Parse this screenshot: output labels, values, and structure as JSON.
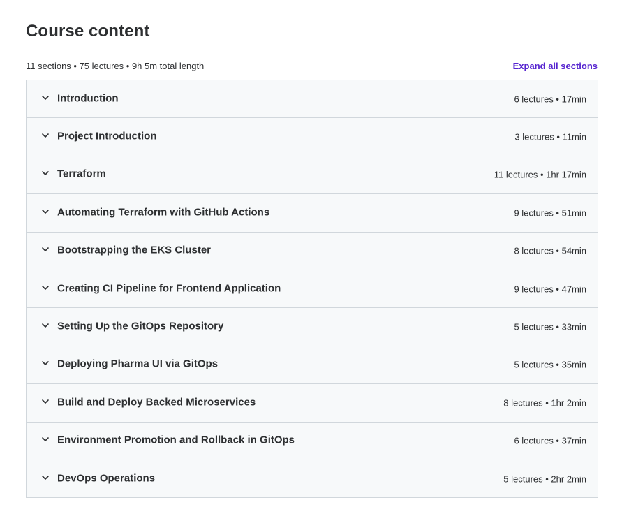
{
  "page": {
    "title": "Course content",
    "summary": "11 sections • 75 lectures • 9h 5m total length",
    "expand_all_label": "Expand all sections"
  },
  "colors": {
    "accent": "#5624d0",
    "section_bg": "#f7f9fa",
    "border": "#d1d7dc",
    "text": "#2d2f31"
  },
  "icons": {
    "section_toggle": "chevron-down-icon"
  },
  "sections": [
    {
      "title": "Introduction",
      "meta": "6 lectures • 17min"
    },
    {
      "title": "Project Introduction",
      "meta": "3 lectures • 11min"
    },
    {
      "title": "Terraform",
      "meta": "11 lectures • 1hr 17min"
    },
    {
      "title": "Automating Terraform with GitHub Actions",
      "meta": "9 lectures • 51min"
    },
    {
      "title": "Bootstrapping the EKS Cluster",
      "meta": "8 lectures • 54min"
    },
    {
      "title": "Creating CI Pipeline for Frontend Application",
      "meta": "9 lectures • 47min"
    },
    {
      "title": "Setting Up the GitOps Repository",
      "meta": "5 lectures • 33min"
    },
    {
      "title": "Deploying Pharma UI via GitOps",
      "meta": "5 lectures • 35min"
    },
    {
      "title": "Build and Deploy Backed Microservices",
      "meta": "8 lectures • 1hr 2min"
    },
    {
      "title": "Environment Promotion and Rollback in GitOps",
      "meta": "6 lectures • 37min"
    },
    {
      "title": "DevOps Operations",
      "meta": "5 lectures • 2hr 2min"
    }
  ]
}
